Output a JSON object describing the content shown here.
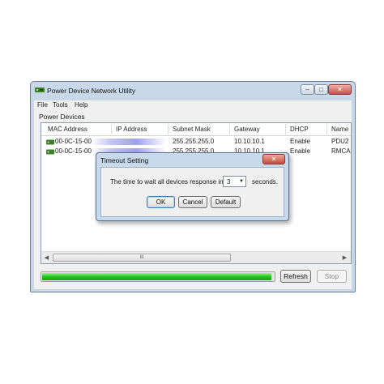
{
  "window": {
    "title": "Power Device Network Utility",
    "controls": {
      "minimize": "–",
      "maximize": "□",
      "close": "✕"
    }
  },
  "menu": [
    "File",
    "Tools",
    "Help"
  ],
  "devices": {
    "group_label": "Power Devices",
    "columns": [
      "MAC Address",
      "IP Address",
      "Subnet Mask",
      "Gateway",
      "DHCP",
      "Name"
    ],
    "rows": [
      {
        "mac": "00-0C-15-00",
        "subnet": "255.255.255.0",
        "gateway": "10.10.10.1",
        "dhcp": "Enable",
        "name": "PDU2"
      },
      {
        "mac": "00-0C-15-00",
        "subnet": "255.255.255.0",
        "gateway": "10.10.10.1",
        "dhcp": "Enable",
        "name": "RMCA"
      }
    ],
    "scroll_grip": "III"
  },
  "progress": {
    "fraction": 0.99
  },
  "buttons": {
    "refresh": "Refresh",
    "stop": "Stop"
  },
  "dialog": {
    "title": "Timeout Setting",
    "close": "✕",
    "message": "The time to wait all devices response in",
    "timeout_value": "3",
    "unit": "seconds.",
    "ok": "OK",
    "cancel": "Cancel",
    "default": "Default"
  },
  "colors": {
    "progress_green": "#22c41b",
    "dialog_frame": "#c8d9ec"
  },
  "icons": {
    "app": "network-device-icon",
    "row": "network-device-icon",
    "dropdown": "triangle-down-icon"
  }
}
